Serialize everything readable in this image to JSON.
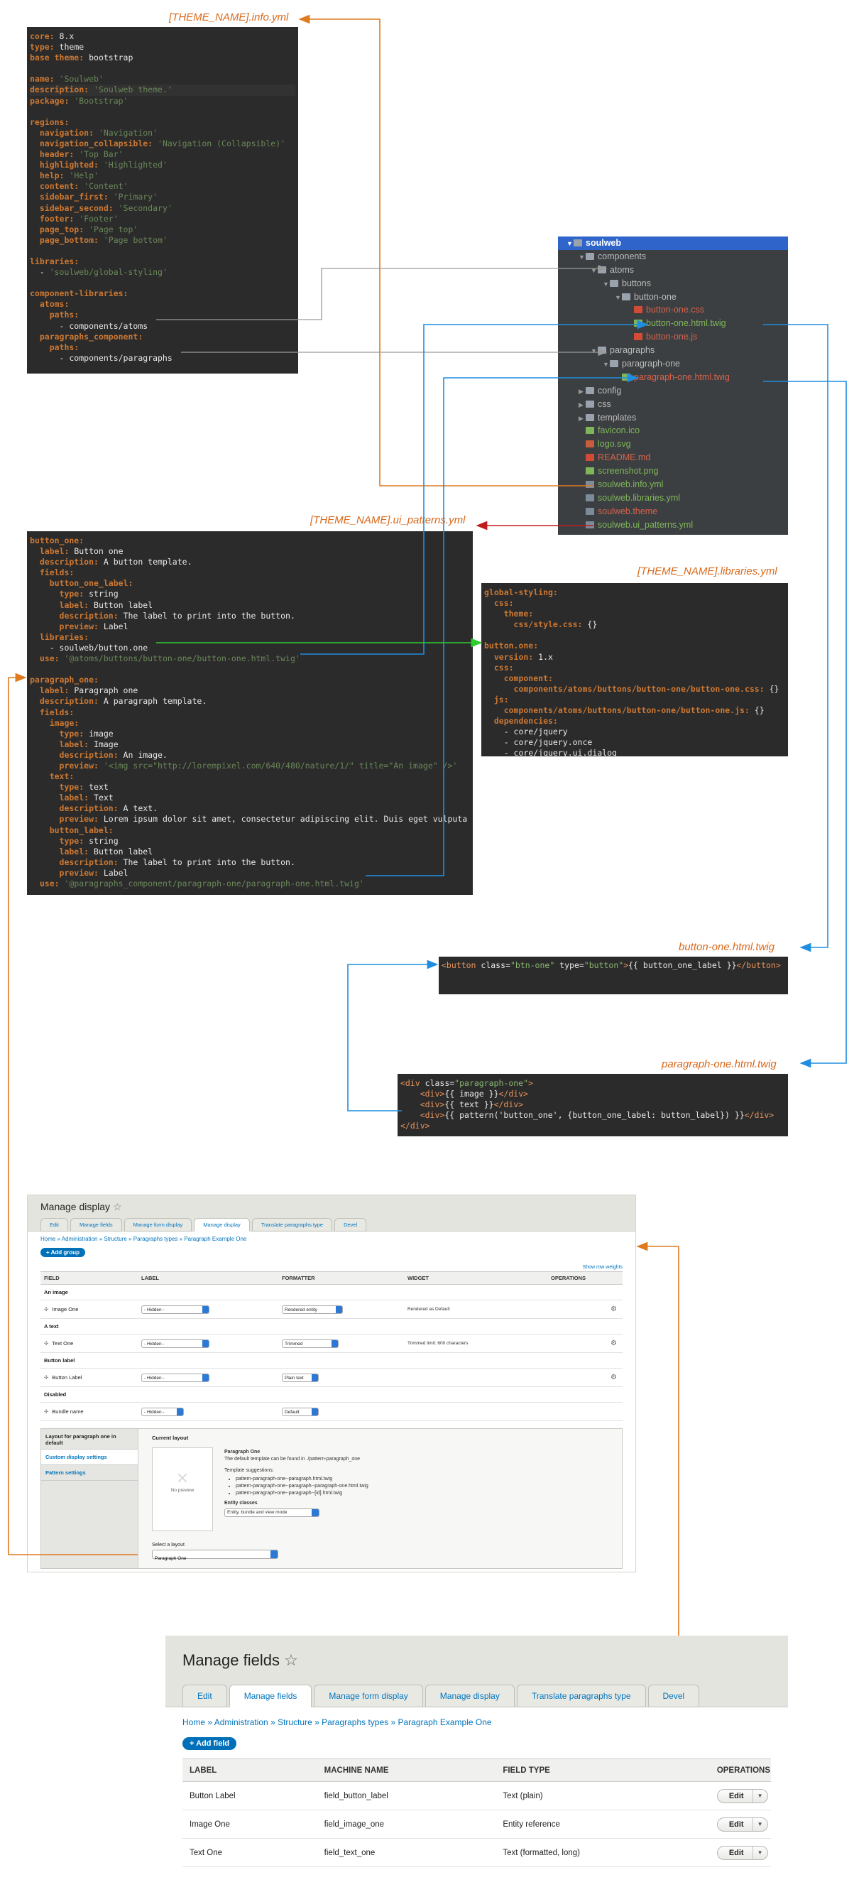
{
  "captions": {
    "info_yml": "[THEME_NAME].info.yml",
    "ui_patterns_yml": "[THEME_NAME].ui_patterns.yml",
    "libraries_yml": "[THEME_NAME].libraries.yml",
    "button_twig": "button-one.html.twig",
    "paragraph_twig": "paragraph-one.html.twig"
  },
  "info_yml": {
    "lines": [
      [
        [
          "k",
          "core:"
        ],
        [
          "w",
          " 8.x"
        ]
      ],
      [
        [
          "k",
          "type:"
        ],
        [
          "w",
          " theme"
        ]
      ],
      [
        [
          "k",
          "base theme:"
        ],
        [
          "w",
          " bootstrap"
        ]
      ],
      [],
      [
        [
          "k",
          "name:"
        ],
        [
          "s",
          " 'Soulweb'"
        ]
      ],
      [
        [
          "k",
          "description:"
        ],
        [
          "s",
          " 'Soulweb theme.'"
        ]
      ],
      [
        [
          "k",
          "package:"
        ],
        [
          "s",
          " 'Bootstrap'"
        ]
      ],
      [],
      [
        [
          "k",
          "regions:"
        ]
      ],
      [
        [
          "k",
          "  navigation:"
        ],
        [
          "s",
          " 'Navigation'"
        ]
      ],
      [
        [
          "k",
          "  navigation_collapsible:"
        ],
        [
          "s",
          " 'Navigation (Collapsible)'"
        ]
      ],
      [
        [
          "k",
          "  header:"
        ],
        [
          "s",
          " 'Top Bar'"
        ]
      ],
      [
        [
          "k",
          "  highlighted:"
        ],
        [
          "s",
          " 'Highlighted'"
        ]
      ],
      [
        [
          "k",
          "  help:"
        ],
        [
          "s",
          " 'Help'"
        ]
      ],
      [
        [
          "k",
          "  content:"
        ],
        [
          "s",
          " 'Content'"
        ]
      ],
      [
        [
          "k",
          "  sidebar_first:"
        ],
        [
          "s",
          " 'Primary'"
        ]
      ],
      [
        [
          "k",
          "  sidebar_second:"
        ],
        [
          "s",
          " 'Secondary'"
        ]
      ],
      [
        [
          "k",
          "  footer:"
        ],
        [
          "s",
          " 'Footer'"
        ]
      ],
      [
        [
          "k",
          "  page_top:"
        ],
        [
          "s",
          " 'Page top'"
        ]
      ],
      [
        [
          "k",
          "  page_bottom:"
        ],
        [
          "s",
          " 'Page bottom'"
        ]
      ],
      [],
      [
        [
          "k",
          "libraries:"
        ]
      ],
      [
        [
          "w",
          "  - "
        ],
        [
          "s",
          "'soulweb/global-styling'"
        ]
      ],
      [],
      [
        [
          "k",
          "component-libraries:"
        ]
      ],
      [
        [
          "k",
          "  atoms:"
        ]
      ],
      [
        [
          "k",
          "    paths:"
        ]
      ],
      [
        [
          "w",
          "      - components/atoms"
        ]
      ],
      [
        [
          "k",
          "  paragraphs_component:"
        ]
      ],
      [
        [
          "k",
          "    paths:"
        ]
      ],
      [
        [
          "w",
          "      - components/paragraphs"
        ]
      ]
    ]
  },
  "tree": {
    "items": [
      {
        "label": "soulweb",
        "depth": 0,
        "twisty": "▼",
        "kind": "fold",
        "cls": "sel"
      },
      {
        "label": "components",
        "depth": 1,
        "twisty": "▼",
        "kind": "fold",
        "cls": ""
      },
      {
        "label": "atoms",
        "depth": 2,
        "twisty": "▼",
        "kind": "fold",
        "cls": ""
      },
      {
        "label": "buttons",
        "depth": 3,
        "twisty": "▼",
        "kind": "fold",
        "cls": ""
      },
      {
        "label": "button-one",
        "depth": 4,
        "twisty": "▼",
        "kind": "fold",
        "cls": ""
      },
      {
        "label": "button-one.css",
        "depth": 5,
        "twisty": "",
        "kind": "fcss",
        "cls": "red"
      },
      {
        "label": "button-one.html.twig",
        "depth": 5,
        "twisty": "",
        "kind": "ftwig",
        "cls": "green"
      },
      {
        "label": "button-one.js",
        "depth": 5,
        "twisty": "",
        "kind": "fcss",
        "cls": "red"
      },
      {
        "label": "paragraphs",
        "depth": 2,
        "twisty": "▼",
        "kind": "fold",
        "cls": ""
      },
      {
        "label": "paragraph-one",
        "depth": 3,
        "twisty": "▼",
        "kind": "fold",
        "cls": ""
      },
      {
        "label": "paragraph-one.html.twig",
        "depth": 4,
        "twisty": "",
        "kind": "ftwig",
        "cls": "red"
      },
      {
        "label": "config",
        "depth": 1,
        "twisty": "▶",
        "kind": "fold",
        "cls": ""
      },
      {
        "label": "css",
        "depth": 1,
        "twisty": "▶",
        "kind": "fold",
        "cls": ""
      },
      {
        "label": "templates",
        "depth": 1,
        "twisty": "▶",
        "kind": "fold",
        "cls": ""
      },
      {
        "label": "favicon.ico",
        "depth": 1,
        "twisty": "",
        "kind": "ftwig",
        "cls": "green"
      },
      {
        "label": "logo.svg",
        "depth": 1,
        "twisty": "",
        "kind": "fmisc",
        "cls": "green"
      },
      {
        "label": "README.md",
        "depth": 1,
        "twisty": "",
        "kind": "fcss",
        "cls": "red"
      },
      {
        "label": "screenshot.png",
        "depth": 1,
        "twisty": "",
        "kind": "ftwig",
        "cls": "green"
      },
      {
        "label": "soulweb.info.yml",
        "depth": 1,
        "twisty": "",
        "kind": "fyml",
        "cls": "green"
      },
      {
        "label": "soulweb.libraries.yml",
        "depth": 1,
        "twisty": "",
        "kind": "fyml",
        "cls": "green"
      },
      {
        "label": "soulweb.theme",
        "depth": 1,
        "twisty": "",
        "kind": "fyml",
        "cls": "red"
      },
      {
        "label": "soulweb.ui_patterns.yml",
        "depth": 1,
        "twisty": "",
        "kind": "fyml",
        "cls": "green"
      }
    ]
  },
  "ui_patterns_yml": {
    "lines": [
      [
        [
          "k",
          "button_one:"
        ]
      ],
      [
        [
          "k",
          "  label:"
        ],
        [
          "w",
          " Button one"
        ]
      ],
      [
        [
          "k",
          "  description:"
        ],
        [
          "w",
          " A button template."
        ]
      ],
      [
        [
          "k",
          "  fields:"
        ]
      ],
      [
        [
          "k",
          "    button_one_label:"
        ]
      ],
      [
        [
          "k",
          "      type:"
        ],
        [
          "w",
          " string"
        ]
      ],
      [
        [
          "k",
          "      label:"
        ],
        [
          "w",
          " Button label"
        ]
      ],
      [
        [
          "k",
          "      description:"
        ],
        [
          "w",
          " The label to print into the button."
        ]
      ],
      [
        [
          "k",
          "      preview:"
        ],
        [
          "w",
          " Label"
        ]
      ],
      [
        [
          "k",
          "  libraries:"
        ]
      ],
      [
        [
          "w",
          "    - soulweb/button.one"
        ]
      ],
      [
        [
          "k",
          "  use:"
        ],
        [
          "s",
          " '@atoms/buttons/button-one/button-one.html.twig'"
        ]
      ],
      [],
      [
        [
          "k",
          "paragraph_one:"
        ]
      ],
      [
        [
          "k",
          "  label:"
        ],
        [
          "w",
          " Paragraph one"
        ]
      ],
      [
        [
          "k",
          "  description:"
        ],
        [
          "w",
          " A paragraph template."
        ]
      ],
      [
        [
          "k",
          "  fields:"
        ]
      ],
      [
        [
          "k",
          "    image:"
        ]
      ],
      [
        [
          "k",
          "      type:"
        ],
        [
          "w",
          " image"
        ]
      ],
      [
        [
          "k",
          "      label:"
        ],
        [
          "w",
          " Image"
        ]
      ],
      [
        [
          "k",
          "      description:"
        ],
        [
          "w",
          " An image."
        ]
      ],
      [
        [
          "k",
          "      preview:"
        ],
        [
          "s",
          " '<img src=\"http://lorempixel.com/640/480/nature/1/\" title=\"An image\" />'"
        ]
      ],
      [
        [
          "k",
          "    text:"
        ]
      ],
      [
        [
          "k",
          "      type:"
        ],
        [
          "w",
          " text"
        ]
      ],
      [
        [
          "k",
          "      label:"
        ],
        [
          "w",
          " Text"
        ]
      ],
      [
        [
          "k",
          "      description:"
        ],
        [
          "w",
          " A text."
        ]
      ],
      [
        [
          "k",
          "      preview:"
        ],
        [
          "w",
          " Lorem ipsum dolor sit amet, consectetur adipiscing elit. Duis eget vulputa"
        ]
      ],
      [
        [
          "k",
          "    button_label:"
        ]
      ],
      [
        [
          "k",
          "      type:"
        ],
        [
          "w",
          " string"
        ]
      ],
      [
        [
          "k",
          "      label:"
        ],
        [
          "w",
          " Button label"
        ]
      ],
      [
        [
          "k",
          "      description:"
        ],
        [
          "w",
          " The label to print into the button."
        ]
      ],
      [
        [
          "k",
          "      preview:"
        ],
        [
          "w",
          " Label"
        ]
      ],
      [
        [
          "k",
          "  use:"
        ],
        [
          "s",
          " '@paragraphs_component/paragraph-one/paragraph-one.html.twig'"
        ]
      ]
    ]
  },
  "libraries_yml": {
    "lines": [
      [
        [
          "k",
          "global-styling:"
        ]
      ],
      [
        [
          "k",
          "  css:"
        ]
      ],
      [
        [
          "k",
          "    theme:"
        ]
      ],
      [
        [
          "k",
          "      css/style.css:"
        ],
        [
          "w",
          " {}"
        ]
      ],
      [],
      [
        [
          "k",
          "button.one:"
        ]
      ],
      [
        [
          "k",
          "  version:"
        ],
        [
          "w",
          " 1.x"
        ]
      ],
      [
        [
          "k",
          "  css:"
        ]
      ],
      [
        [
          "k",
          "    component:"
        ]
      ],
      [
        [
          "k",
          "      components/atoms/buttons/button-one/button-one.css:"
        ],
        [
          "w",
          " {}"
        ]
      ],
      [
        [
          "k",
          "  js:"
        ]
      ],
      [
        [
          "k",
          "    components/atoms/buttons/button-one/button-one.js:"
        ],
        [
          "w",
          " {}"
        ]
      ],
      [
        [
          "k",
          "  dependencies:"
        ]
      ],
      [
        [
          "w",
          "    - core/jquery"
        ]
      ],
      [
        [
          "w",
          "    - core/jquery.once"
        ]
      ],
      [
        [
          "w",
          "    - core/jquery.ui.dialog"
        ]
      ]
    ]
  },
  "button_twig": {
    "lines": [
      [
        [
          "o",
          "<button"
        ],
        [
          "w",
          " class="
        ],
        [
          "g",
          "\"btn-one\""
        ],
        [
          "w",
          " type="
        ],
        [
          "g",
          "\"button\""
        ],
        [
          "o",
          ">"
        ],
        [
          "w",
          "{{ button_one_label }}"
        ],
        [
          "o",
          "</button>"
        ]
      ]
    ]
  },
  "paragraph_twig": {
    "lines": [
      [
        [
          "o",
          "<div"
        ],
        [
          "w",
          " class="
        ],
        [
          "g",
          "\"paragraph-one\""
        ],
        [
          "o",
          ">"
        ]
      ],
      [
        [
          "w",
          "    "
        ],
        [
          "o",
          "<div>"
        ],
        [
          "w",
          "{{ image }}"
        ],
        [
          "o",
          "</div>"
        ]
      ],
      [
        [
          "w",
          "    "
        ],
        [
          "o",
          "<div>"
        ],
        [
          "w",
          "{{ text }}"
        ],
        [
          "o",
          "</div>"
        ]
      ],
      [
        [
          "w",
          "    "
        ],
        [
          "o",
          "<div>"
        ],
        [
          "w",
          "{{ pattern('button_one', {button_one_label: button_label}) }}"
        ],
        [
          "o",
          "</div>"
        ]
      ],
      [
        [
          "o",
          "</div>"
        ]
      ]
    ]
  },
  "manage_display": {
    "title": "Manage display",
    "star": "☆",
    "tabs": [
      "Edit",
      "Manage fields",
      "Manage form display",
      "Manage display",
      "Translate paragraphs type",
      "Devel"
    ],
    "active_tab": 3,
    "breadcrumb": "Home » Administration » Structure » Paragraphs types » Paragraph Example One",
    "add_group": "+ Add group",
    "show_weights": "Show row weights",
    "headers": [
      "FIELD",
      "LABEL",
      "FORMATTER",
      "WIDGET",
      "OPERATIONS"
    ],
    "rows": [
      {
        "type": "region",
        "label": "An image"
      },
      {
        "type": "field",
        "field": "Image One",
        "label": "- Hidden -",
        "formatter": "Rendered entity",
        "widget": "Rendered as Default",
        "gear": true
      },
      {
        "type": "region",
        "label": "A text"
      },
      {
        "type": "field",
        "field": "Text One",
        "label": "- Hidden -",
        "formatter": "Trimmed",
        "widget": "Trimmed limit: 600 characters",
        "gear": true
      },
      {
        "type": "region",
        "label": "Button label"
      },
      {
        "type": "field",
        "field": "Button Label",
        "label": "- Hidden -",
        "formatter": "Plain text",
        "widget": "",
        "gear": true
      },
      {
        "type": "region",
        "label": "Disabled"
      },
      {
        "type": "field",
        "field": "Bundle name",
        "label": "- Hidden -",
        "formatter": "Default",
        "widget": "",
        "gear": false
      }
    ],
    "layout": {
      "sidebar_title": "Layout for paragraph one in default",
      "sidebar_links": [
        "Custom display settings",
        "Pattern settings"
      ],
      "current_layout": "Current layout",
      "no_preview": "No preview",
      "name": "Paragraph One",
      "desc": "The default template can be found in ./pattern-paragraph_one",
      "suggestions_title": "Template suggestions:",
      "suggestions": [
        "pattern-paragraph-one--paragraph.html.twig",
        "pattern-paragraph-one--paragraph--paragraph-one.html.twig",
        "pattern-paragraph-one--paragraph--[id].html.twig"
      ],
      "entity_classes": "Entity classes",
      "entity_value": "Entity, bundle and view mode",
      "select_label": "Select a layout",
      "select_value": "Paragraph One"
    }
  },
  "manage_fields": {
    "title": "Manage fields",
    "star": "☆",
    "tabs": [
      "Edit",
      "Manage fields",
      "Manage form display",
      "Manage display",
      "Translate paragraphs type",
      "Devel"
    ],
    "active_tab": 1,
    "breadcrumb": "Home » Administration » Structure » Paragraphs types » Paragraph Example One",
    "add_field": "+ Add field",
    "headers": [
      "LABEL",
      "MACHINE NAME",
      "FIELD TYPE",
      "OPERATIONS"
    ],
    "rows": [
      {
        "label": "Button Label",
        "machine": "field_button_label",
        "type": "Text (plain)",
        "op": "Edit"
      },
      {
        "label": "Image One",
        "machine": "field_image_one",
        "type": "Entity reference",
        "op": "Edit"
      },
      {
        "label": "Text One",
        "machine": "field_text_one",
        "type": "Text (formatted, long)",
        "op": "Edit"
      }
    ]
  }
}
